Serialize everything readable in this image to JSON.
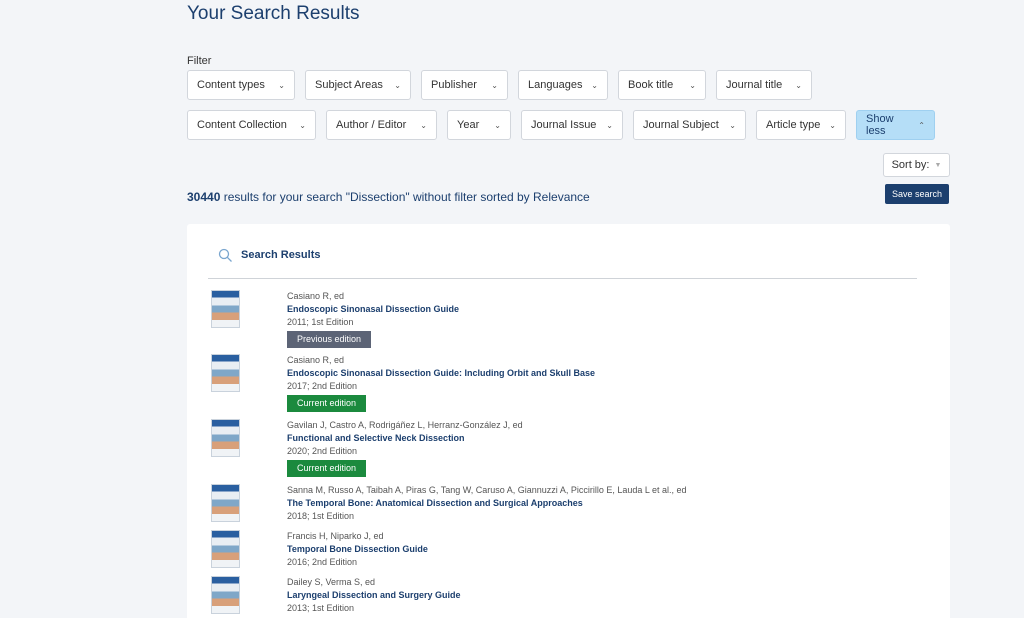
{
  "page": {
    "title": "Your Search Results"
  },
  "filter": {
    "label": "Filter",
    "row1": [
      "Content types",
      "Subject Areas",
      "Publisher",
      "Languages",
      "Book title",
      "Journal title"
    ],
    "row2": [
      "Content Collection",
      "Author / Editor",
      "Year",
      "Journal Issue",
      "Journal Subject",
      "Article type"
    ],
    "show_less": "Show less"
  },
  "sort": {
    "label": "Sort by:"
  },
  "save_search": "Save search",
  "summary": {
    "count": "30440",
    "text": " results  for your search \"Dissection\" without filter sorted by Relevance"
  },
  "panel": {
    "title": "Search Results"
  },
  "results": [
    {
      "authors": "Casiano R, ed",
      "title": "Endoscopic Sinonasal Dissection Guide",
      "edition": "2011; 1st Edition",
      "badge": "Previous edition",
      "badge_type": "prev"
    },
    {
      "authors": "Casiano R, ed",
      "title": "Endoscopic Sinonasal Dissection Guide: Including Orbit and Skull Base",
      "edition": "2017; 2nd Edition",
      "badge": "Current edition",
      "badge_type": "curr"
    },
    {
      "authors": "Gavilan J, Castro A, Rodrigáñez L, Herranz-González J, ed",
      "title": "Functional and Selective Neck Dissection",
      "edition": "2020; 2nd Edition",
      "badge": "Current edition",
      "badge_type": "curr"
    },
    {
      "authors": "Sanna M, Russo A, Taibah A, Piras G, Tang W, Caruso A, Giannuzzi A, Piccirillo E, Lauda L et al., ed",
      "title": "The Temporal Bone: Anatomical Dissection and Surgical Approaches",
      "edition": "2018; 1st Edition",
      "badge": "",
      "badge_type": ""
    },
    {
      "authors": "Francis H, Niparko J, ed",
      "title": "Temporal Bone Dissection Guide",
      "edition": "2016; 2nd Edition",
      "badge": "",
      "badge_type": ""
    },
    {
      "authors": "Dailey S, Verma S, ed",
      "title": "Laryngeal Dissection and Surgery Guide",
      "edition": "2013; 1st Edition",
      "badge": "",
      "badge_type": ""
    }
  ]
}
